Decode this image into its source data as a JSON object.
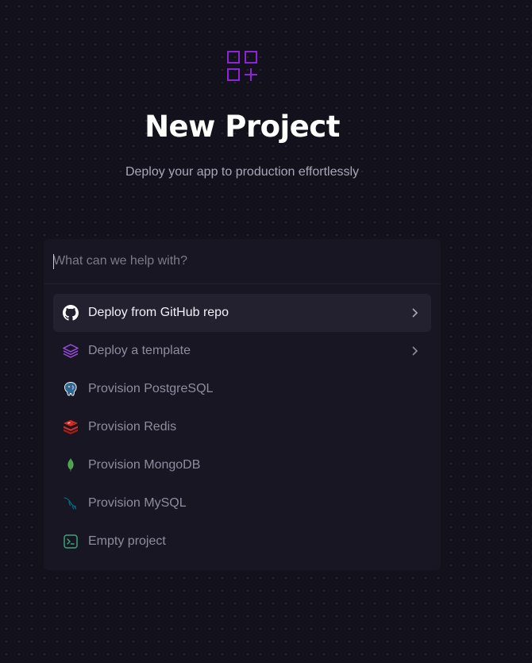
{
  "header": {
    "icon": "apps-add-icon",
    "title": "New Project",
    "subtitle": "Deploy your app to production effortlessly"
  },
  "search": {
    "placeholder": "What can we help with?",
    "value": ""
  },
  "menu": {
    "items": [
      {
        "label": "Deploy from GitHub repo",
        "icon": "github-icon",
        "has_submenu": true,
        "active": true
      },
      {
        "label": "Deploy a template",
        "icon": "layers-icon",
        "has_submenu": true,
        "active": false
      },
      {
        "label": "Provision PostgreSQL",
        "icon": "postgresql-icon",
        "has_submenu": false,
        "active": false
      },
      {
        "label": "Provision Redis",
        "icon": "redis-icon",
        "has_submenu": false,
        "active": false
      },
      {
        "label": "Provision MongoDB",
        "icon": "mongodb-icon",
        "has_submenu": false,
        "active": false
      },
      {
        "label": "Provision MySQL",
        "icon": "mysql-icon",
        "has_submenu": false,
        "active": false
      },
      {
        "label": "Empty project",
        "icon": "terminal-icon",
        "has_submenu": false,
        "active": false
      }
    ]
  },
  "colors": {
    "background": "#13111c",
    "panel": "#181622",
    "accent": "#9c27e0",
    "active_row": "#232130"
  }
}
